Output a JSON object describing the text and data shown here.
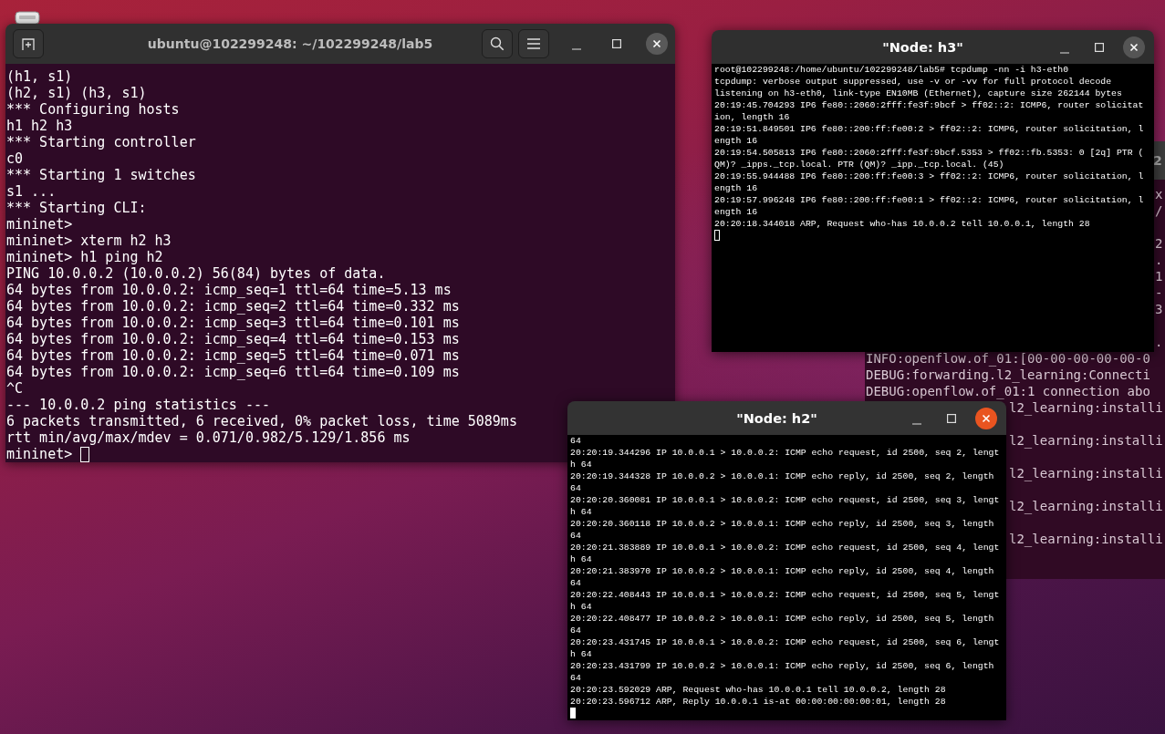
{
  "windows": [
    {
      "kind": "gnome-terminal",
      "title": "ubuntu@102299248: ~/102299248/lab5",
      "focused": false,
      "cursor_filled": false,
      "lines": [
        "(h1, s1)",
        "(h2, s1) (h3, s1)",
        "*** Configuring hosts",
        "h1 h2 h3",
        "*** Starting controller",
        "c0",
        "*** Starting 1 switches",
        "s1 ...",
        "*** Starting CLI:",
        "mininet>",
        "mininet> xterm h2 h3",
        "mininet> h1 ping h2",
        "PING 10.0.0.2 (10.0.0.2) 56(84) bytes of data.",
        "64 bytes from 10.0.0.2: icmp_seq=1 ttl=64 time=5.13 ms",
        "64 bytes from 10.0.0.2: icmp_seq=2 ttl=64 time=0.332 ms",
        "64 bytes from 10.0.0.2: icmp_seq=3 ttl=64 time=0.101 ms",
        "64 bytes from 10.0.0.2: icmp_seq=4 ttl=64 time=0.153 ms",
        "64 bytes from 10.0.0.2: icmp_seq=5 ttl=64 time=0.071 ms",
        "64 bytes from 10.0.0.2: icmp_seq=6 ttl=64 time=0.109 ms",
        "^C",
        "--- 10.0.0.2 ping statistics ---",
        "6 packets transmitted, 6 received, 0% packet loss, time 5089ms",
        "rtt min/avg/max/mdev = 0.071/0.982/5.129/1.856 ms",
        "mininet>"
      ]
    },
    {
      "kind": "xterm",
      "title": "\"Node: h3\"",
      "focused": false,
      "cursor_filled": false,
      "lines": [
        "root@102299248:/home/ubuntu/102299248/lab5# tcpdump -nn -i h3-eth0",
        "tcpdump: verbose output suppressed, use -v or -vv for full protocol decode",
        "listening on h3-eth0, link-type EN10MB (Ethernet), capture size 262144 bytes",
        "20:19:45.704293 IP6 fe80::2060:2fff:fe3f:9bcf > ff02::2: ICMP6, router solicitat",
        "ion, length 16",
        "20:19:51.849501 IP6 fe80::200:ff:fe00:2 > ff02::2: ICMP6, router solicitation, l",
        "ength 16",
        "20:19:54.505813 IP6 fe80::2060:2fff:fe3f:9bcf.5353 > ff02::fb.5353: 0 [2q] PTR (",
        "QM)? _ipps._tcp.local. PTR (QM)? _ipp._tcp.local. (45)",
        "20:19:55.944488 IP6 fe80::200:ff:fe00:3 > ff02::2: ICMP6, router solicitation, l",
        "ength 16",
        "20:19:57.996248 IP6 fe80::200:ff:fe00:1 > ff02::2: ICMP6, router solicitation, l",
        "ength 16",
        "20:20:18.344018 ARP, Request who-has 10.0.0.2 tell 10.0.0.1, length 28"
      ]
    },
    {
      "kind": "background-terminal",
      "title": "2",
      "lines": [
        {
          "kind": "edge",
          "text": "x"
        },
        {
          "kind": "edge",
          "text": "/"
        },
        {
          "kind": "blank"
        },
        {
          "kind": "edge",
          "text": "2"
        },
        {
          "kind": "edge",
          "text": "."
        },
        {
          "kind": "edge",
          "text": "1"
        },
        {
          "kind": "edge",
          "text": "-"
        },
        {
          "kind": "edge",
          "text": "3"
        },
        {
          "kind": "blank"
        },
        {
          "kind": "edge",
          "text": "."
        },
        {
          "kind": "full",
          "text": "INFO:openflow.of_01:[00-00-00-00-00-0"
        },
        {
          "kind": "full",
          "text": "DEBUG:forwarding.l2_learning:Connecti"
        },
        {
          "kind": "full",
          "text": "DEBUG:openflow.of_01:1 connection abo"
        },
        {
          "kind": "tail",
          "text": "l2_learning:installi"
        },
        {
          "kind": "blank"
        },
        {
          "kind": "tail",
          "text": "l2_learning:installi"
        },
        {
          "kind": "blank"
        },
        {
          "kind": "tail",
          "text": "l2_learning:installi"
        },
        {
          "kind": "blank"
        },
        {
          "kind": "tail",
          "text": "l2_learning:installi"
        },
        {
          "kind": "blank"
        },
        {
          "kind": "tail",
          "text": "l2_learning:installi"
        }
      ]
    },
    {
      "kind": "xterm",
      "title": "\"Node: h2\"",
      "focused": true,
      "cursor_filled": true,
      "lines": [
        "64",
        "20:20:19.344296 IP 10.0.0.1 > 10.0.0.2: ICMP echo request, id 2500, seq 2, lengt",
        "h 64",
        "20:20:19.344328 IP 10.0.0.2 > 10.0.0.1: ICMP echo reply, id 2500, seq 2, length",
        "64",
        "20:20:20.360081 IP 10.0.0.1 > 10.0.0.2: ICMP echo request, id 2500, seq 3, lengt",
        "h 64",
        "20:20:20.360118 IP 10.0.0.2 > 10.0.0.1: ICMP echo reply, id 2500, seq 3, length",
        "64",
        "20:20:21.383889 IP 10.0.0.1 > 10.0.0.2: ICMP echo request, id 2500, seq 4, lengt",
        "h 64",
        "20:20:21.383970 IP 10.0.0.2 > 10.0.0.1: ICMP echo reply, id 2500, seq 4, length",
        "64",
        "20:20:22.408443 IP 10.0.0.1 > 10.0.0.2: ICMP echo request, id 2500, seq 5, lengt",
        "h 64",
        "20:20:22.408477 IP 10.0.0.2 > 10.0.0.1: ICMP echo reply, id 2500, seq 5, length",
        "64",
        "20:20:23.431745 IP 10.0.0.1 > 10.0.0.2: ICMP echo request, id 2500, seq 6, lengt",
        "h 64",
        "20:20:23.431799 IP 10.0.0.2 > 10.0.0.1: ICMP echo reply, id 2500, seq 6, length",
        "64",
        "20:20:23.592029 ARP, Request who-has 10.0.0.1 tell 10.0.0.2, length 28",
        "20:20:23.596712 ARP, Reply 10.0.0.1 is-at 00:00:00:00:00:01, length 28"
      ]
    }
  ]
}
